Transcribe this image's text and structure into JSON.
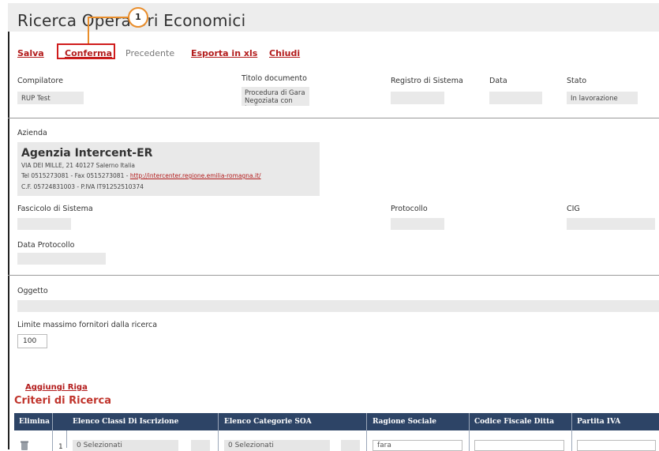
{
  "header": {
    "title": "Ricerca Operatori Economici",
    "callout": "1"
  },
  "toolbar": {
    "save": "Salva",
    "confirm": "Conferma",
    "previous": "Precedente",
    "export": "Esporta in xls",
    "close": "Chiudi"
  },
  "fields": {
    "compiler": {
      "label": "Compilatore",
      "value": "RUP Test"
    },
    "doc_title": {
      "label": "Titolo documento",
      "value": "Procedura di Gara Negoziata con Invito"
    },
    "registry": {
      "label": "Registro di Sistema",
      "value": ""
    },
    "date": {
      "label": "Data",
      "value": ""
    },
    "status": {
      "label": "Stato",
      "value": "In lavorazione"
    }
  },
  "company": {
    "label": "Azienda",
    "name": "Agenzia Intercent-ER",
    "address": "VIA DEI MILLE, 21 40127 Salerno Italia",
    "contacts": "Tel 0515273081 - Fax 0515273081 - ",
    "url": "http://intercenter.regione.emilia-romagna.it/",
    "fiscal": "C.F. 05724831003 - P.IVA IT91252510374"
  },
  "fascicolo": {
    "label": "Fascicolo di Sistema",
    "value": ""
  },
  "protocollo": {
    "label": "Protocollo",
    "value": ""
  },
  "cig": {
    "label": "CIG",
    "value": ""
  },
  "data_protocollo": {
    "label": "Data Protocollo",
    "value": ""
  },
  "oggetto": {
    "label": "Oggetto",
    "value": ""
  },
  "limite": {
    "label": "Limite massimo fornitori dalla ricerca",
    "value": "100"
  },
  "criteria": {
    "add_row": "Aggiungi Riga",
    "title": "Criteri di Ricerca",
    "columns": [
      "Elimina",
      "Elenco Classi Di Iscrizione",
      "Elenco Categorie SOA",
      "Ragione Sociale",
      "Codice Fiscale Ditta",
      "Partita IVA"
    ],
    "rows": [
      {
        "num": "1",
        "classi": "0 Selezionati",
        "soa": "0 Selezionati",
        "ragione": "fara",
        "cf": "",
        "piva": ""
      }
    ]
  }
}
